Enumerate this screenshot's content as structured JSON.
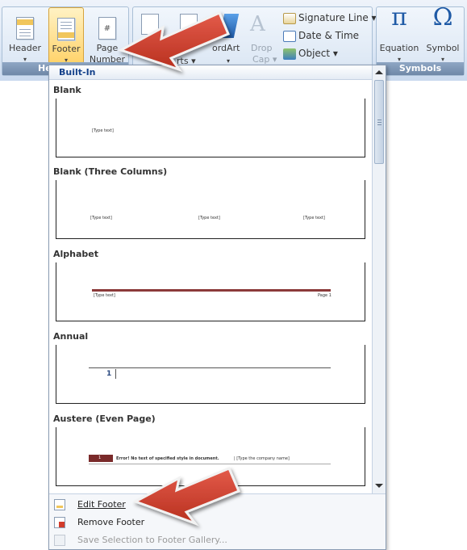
{
  "ribbon": {
    "header_fragment": "He",
    "symbols_label": "Symbols",
    "buttons": {
      "header": {
        "label": "Header",
        "dropdown": "▾"
      },
      "footer": {
        "label": "Footer",
        "dropdown": "▾"
      },
      "page_number": {
        "label": "Page",
        "label2": "Number ▾"
      },
      "wordart": {
        "label": "ordArt",
        "dropdown": "▾"
      },
      "wordart_fragment": "rts ▾",
      "drop_cap": {
        "label": "Drop",
        "label2": "Cap ▾"
      },
      "signature_line": "Signature Line ▾",
      "date_time": "Date & Time",
      "object": "Object ▾",
      "equation": {
        "label": "Equation",
        "dropdown": "▾"
      },
      "symbol": {
        "label": "Symbol",
        "dropdown": "▾"
      }
    },
    "symbol_glyphs": {
      "equation": "π",
      "symbol": "Ω"
    }
  },
  "gallery": {
    "header": "Built-In",
    "sections": [
      {
        "title": "Blank",
        "placeholders": [
          "[Type text]"
        ]
      },
      {
        "title": "Blank (Three Columns)",
        "placeholders": [
          "[Type text]",
          "[Type text]",
          "[Type text]"
        ]
      },
      {
        "title": "Alphabet",
        "placeholders": [
          "[Type text]",
          "Page 1"
        ]
      },
      {
        "title": "Annual",
        "placeholders": [
          "1"
        ]
      },
      {
        "title": "Austere (Even Page)",
        "placeholders": [
          "1",
          "Error! No text of specified style in document.",
          "| [Type the company name]"
        ]
      }
    ],
    "menu": [
      {
        "label": "Edit Footer",
        "enabled": true
      },
      {
        "label": "Remove Footer",
        "enabled": true
      },
      {
        "label": "Save Selection to Footer Gallery...",
        "enabled": false
      }
    ]
  },
  "colors": {
    "accent": "#15428b",
    "arrow": "#c0392b",
    "austere_bar": "#7a2a2a",
    "alphabet_rule": "#8b3a3a"
  }
}
